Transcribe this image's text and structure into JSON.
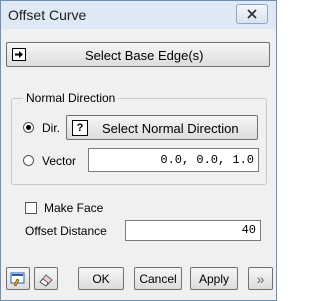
{
  "window": {
    "title": "Offset Curve"
  },
  "buttons": {
    "select_base_edge": "Select Base Edge(s)",
    "select_normal_direction": "Select Normal Direction",
    "ok": "OK",
    "cancel": "Cancel",
    "apply": "Apply",
    "more": "»"
  },
  "normal_direction": {
    "group_label": "Normal Direction",
    "dir_label": "Dir.",
    "vector_label": "Vector",
    "vector_value": "0.0, 0.0, 1.0",
    "selected": "Dir."
  },
  "make_face": {
    "label": "Make Face",
    "checked": false
  },
  "offset_distance": {
    "label": "Offset Distance",
    "value": "40"
  },
  "icons": {
    "close": "close-icon",
    "select_arrow": "arrow-right-icon",
    "help": "question-mark-icon",
    "bottom_left_1": "edit-icon",
    "bottom_left_2": "eraser-icon"
  }
}
